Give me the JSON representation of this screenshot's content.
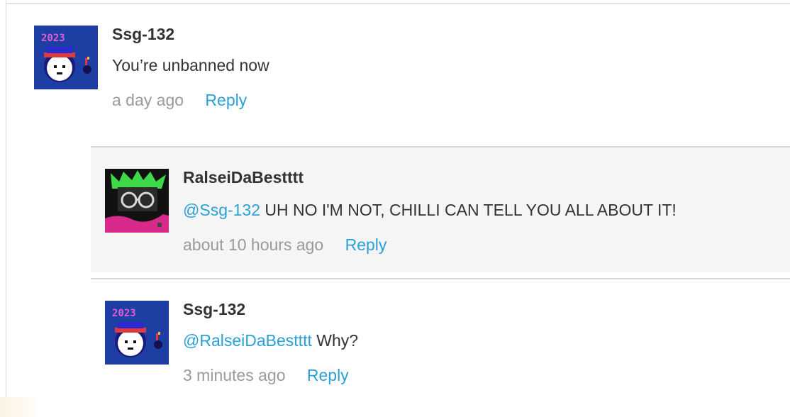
{
  "comments": [
    {
      "author": "Ssg-132",
      "avatar": "ssg-132-avatar",
      "body": "You’re unbanned now",
      "timestamp": "a day ago",
      "reply_label": "Reply"
    },
    {
      "author": "RalseiDaBestttt",
      "avatar": "ralseidabestttt-avatar",
      "mention": "@Ssg-132",
      "body": " UH NO I'M NOT, CHILLI CAN TELL YOU ALL ABOUT IT!",
      "timestamp": "about 10 hours ago",
      "reply_label": "Reply"
    },
    {
      "author": "Ssg-132",
      "avatar": "ssg-132-avatar",
      "mention": "@RalseiDaBestttt",
      "body": " Why?",
      "timestamp": "3 minutes ago",
      "reply_label": "Reply"
    }
  ],
  "avatar_text": {
    "year": "2023"
  },
  "colors": {
    "link": "#2a9fd8",
    "text": "#333333",
    "muted": "#9a9a9a",
    "reply_bg": "#f5f5f5",
    "avatar_ssg_bg": "#1d3fa3",
    "avatar_ralsei_bg": "#111111"
  }
}
